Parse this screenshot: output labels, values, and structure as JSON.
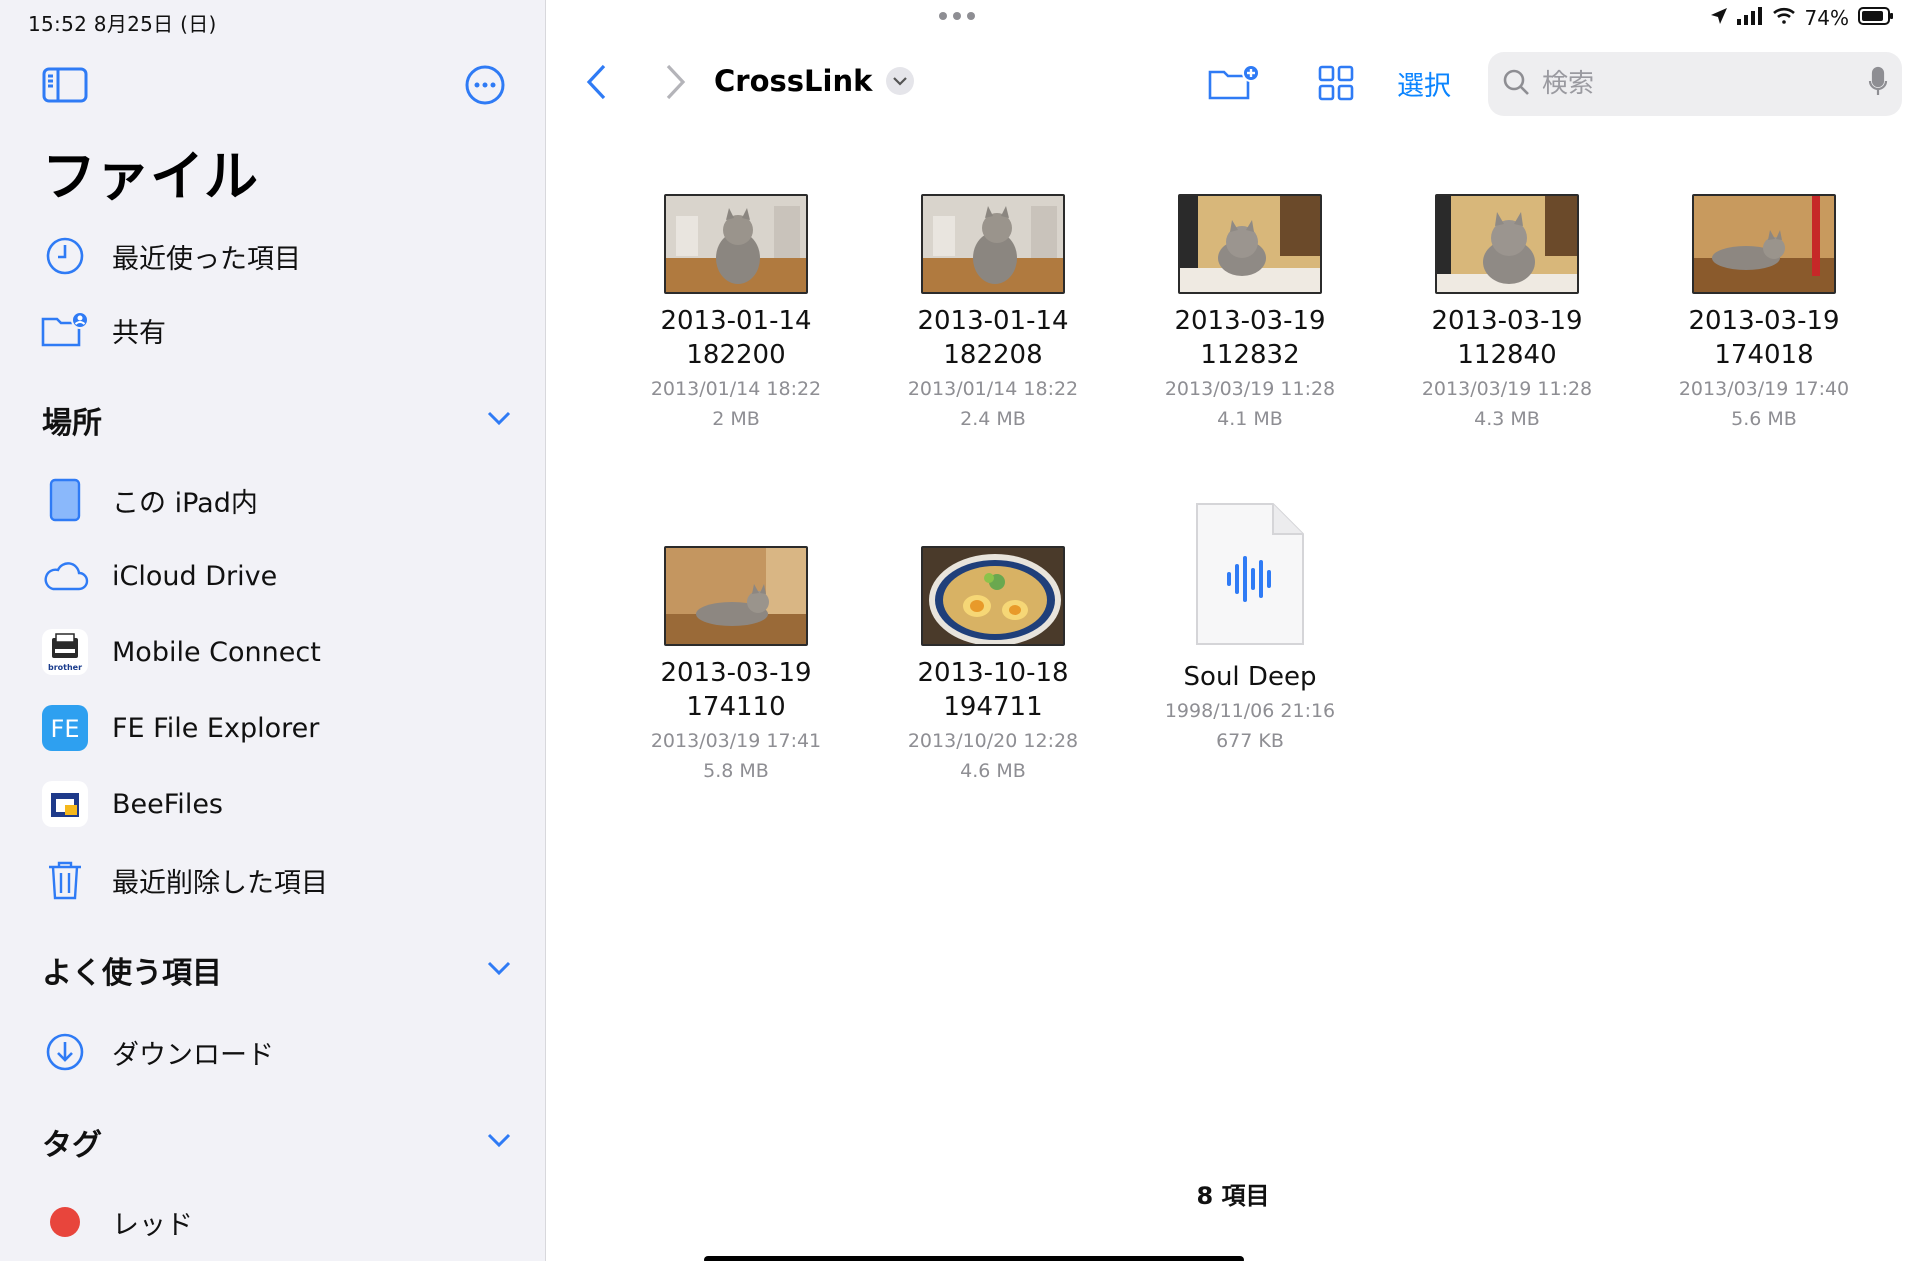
{
  "status": {
    "time_date": "15:52   8月25日 (日)",
    "battery": "74%"
  },
  "sidebar": {
    "title": "ファイル",
    "top_items": [
      {
        "label": "最近使った項目",
        "icon": "clock-icon"
      },
      {
        "label": "共有",
        "icon": "shared-folder-icon"
      }
    ],
    "sections": {
      "locations": {
        "label": "場所",
        "items": [
          {
            "label": "この iPad内",
            "icon": "ipad-icon"
          },
          {
            "label": "iCloud Drive",
            "icon": "cloud-icon"
          },
          {
            "label": "Mobile Connect",
            "icon": "brother-app-icon",
            "brand": "brother"
          },
          {
            "label": "FE File Explorer",
            "icon": "fe-app-icon",
            "brand": "FE"
          },
          {
            "label": "BeeFiles",
            "icon": "beefiles-app-icon"
          },
          {
            "label": "最近削除した項目",
            "icon": "trash-icon"
          }
        ]
      },
      "favorites": {
        "label": "よく使う項目",
        "items": [
          {
            "label": "ダウンロード",
            "icon": "download-icon"
          }
        ]
      },
      "tags": {
        "label": "タグ",
        "items": [
          {
            "label": "レッド",
            "color": "#e8453c"
          }
        ]
      }
    }
  },
  "main": {
    "folder_title": "CrossLink",
    "select_label": "選択",
    "search_placeholder": "検索",
    "files": [
      {
        "name_line1": "2013-01-14",
        "name_line2": "182200",
        "date": "2013/01/14 18:22",
        "size": "2 MB",
        "thumb": "cat-kitchen"
      },
      {
        "name_line1": "2013-01-14",
        "name_line2": "182208",
        "date": "2013/01/14 18:22",
        "size": "2.4 MB",
        "thumb": "cat-kitchen"
      },
      {
        "name_line1": "2013-03-19",
        "name_line2": "112832",
        "date": "2013/03/19 11:28",
        "size": "4.1 MB",
        "thumb": "cat-table"
      },
      {
        "name_line1": "2013-03-19",
        "name_line2": "112840",
        "date": "2013/03/19 11:28",
        "size": "4.3 MB",
        "thumb": "cat-table"
      },
      {
        "name_line1": "2013-03-19",
        "name_line2": "174018",
        "date": "2013/03/19 17:40",
        "size": "5.6 MB",
        "thumb": "cat-lying"
      },
      {
        "name_line1": "2013-03-19",
        "name_line2": "174110",
        "date": "2013/03/19 17:41",
        "size": "5.8 MB",
        "thumb": "cat-lying"
      },
      {
        "name_line1": "2013-10-18",
        "name_line2": "194711",
        "date": "2013/10/20 12:28",
        "size": "4.6 MB",
        "thumb": "ramen"
      },
      {
        "name_line1": "Soul Deep",
        "name_line2": "",
        "date": "1998/11/06 21:16",
        "size": "677 KB",
        "thumb": "audio-doc"
      }
    ],
    "item_count": "8 項目"
  },
  "colors": {
    "accent": "#2f7bf5",
    "sidebar_bg": "#f2f2f7",
    "secondary_text": "#8e8e93"
  }
}
